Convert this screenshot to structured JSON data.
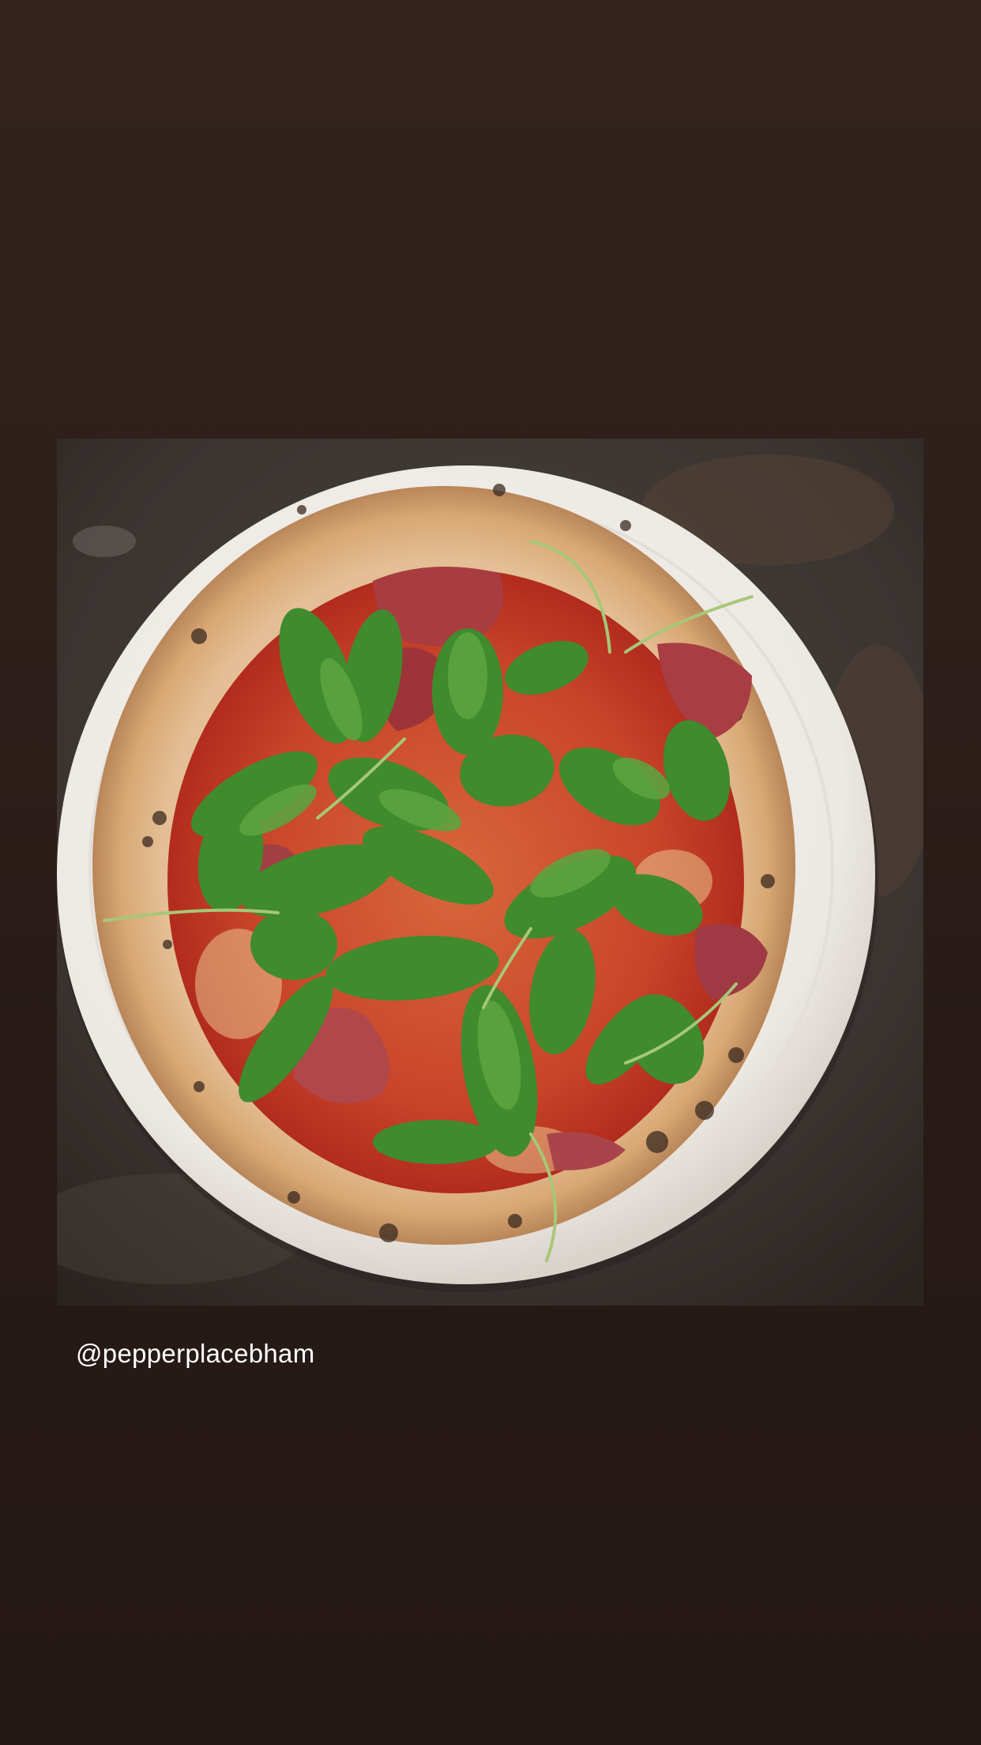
{
  "story": {
    "background_color": "#2a1d19",
    "post": {
      "mention": "@pepperplacebham"
    }
  },
  "colors": {
    "surface": "#3d3835",
    "plate": "#f1eeea",
    "crust": "#dcb28a",
    "sauce": "#c3261c",
    "prosciutto": "#a33b3d",
    "arugula": "#3e8a2c"
  }
}
